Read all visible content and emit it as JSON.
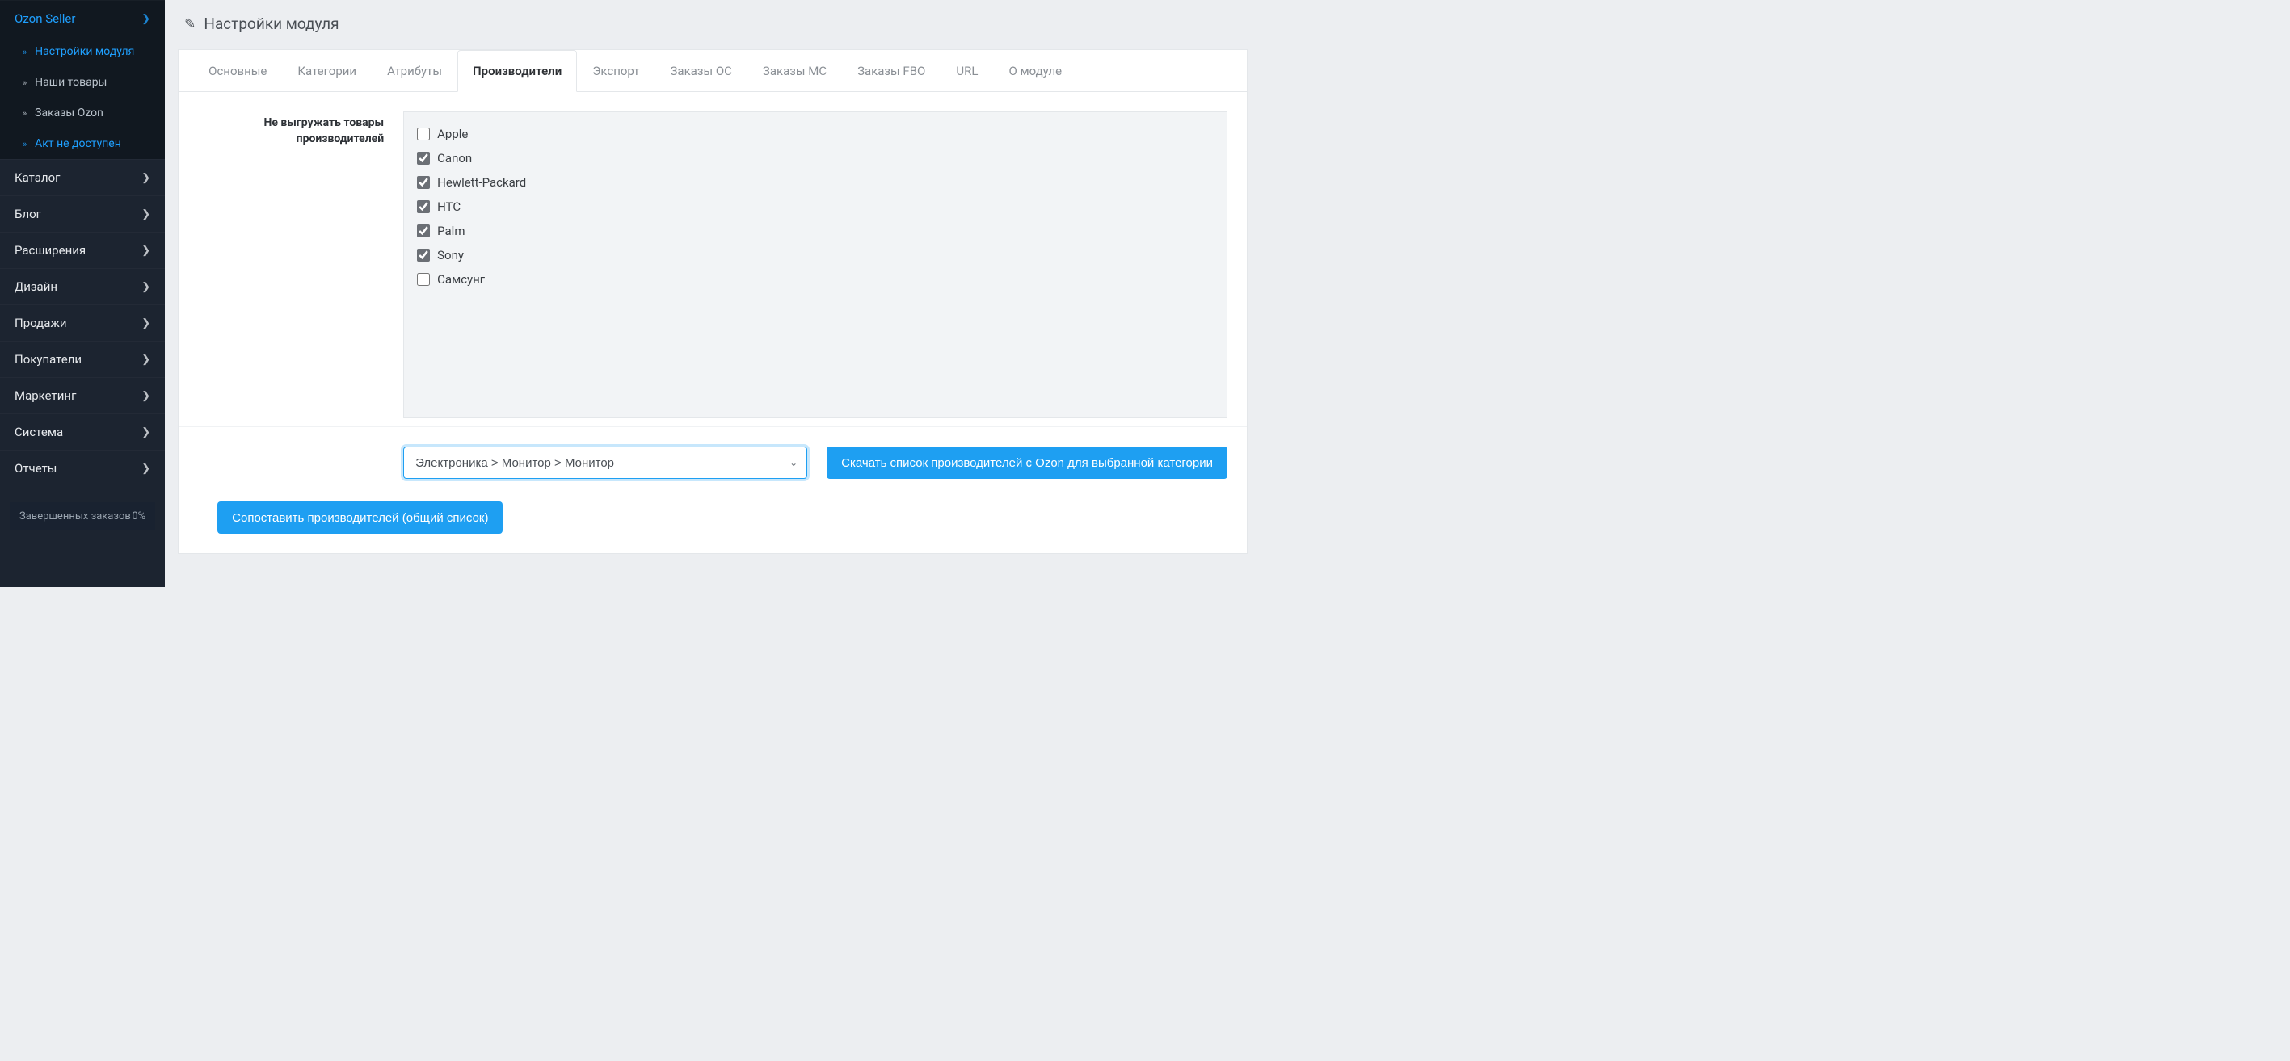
{
  "sidebar": {
    "ozon_seller": {
      "label": "Ozon Seller"
    },
    "sub": [
      {
        "label": "Настройки модуля",
        "active": true
      },
      {
        "label": "Наши товары",
        "active": false
      },
      {
        "label": "Заказы Ozon",
        "active": false
      },
      {
        "label": "Акт не доступен",
        "active": true
      }
    ],
    "items": [
      {
        "label": "Каталог"
      },
      {
        "label": "Блог"
      },
      {
        "label": "Расширения"
      },
      {
        "label": "Дизайн"
      },
      {
        "label": "Продажи"
      },
      {
        "label": "Покупатели"
      },
      {
        "label": "Маркетинг"
      },
      {
        "label": "Система"
      },
      {
        "label": "Отчеты"
      }
    ],
    "footer": {
      "label": "Завершенных заказов",
      "value": "0%"
    }
  },
  "page": {
    "title": "Настройки модуля"
  },
  "tabs": [
    {
      "label": "Основные",
      "active": false
    },
    {
      "label": "Категории",
      "active": false
    },
    {
      "label": "Атрибуты",
      "active": false
    },
    {
      "label": "Производители",
      "active": true
    },
    {
      "label": "Экспорт",
      "active": false
    },
    {
      "label": "Заказы ОС",
      "active": false
    },
    {
      "label": "Заказы МС",
      "active": false
    },
    {
      "label": "Заказы FBO",
      "active": false
    },
    {
      "label": "URL",
      "active": false
    },
    {
      "label": "О модуле",
      "active": false
    }
  ],
  "form": {
    "exclude_label": "Не выгружать товары производителей",
    "manufacturers": [
      {
        "name": "Apple",
        "checked": false
      },
      {
        "name": "Canon",
        "checked": true
      },
      {
        "name": "Hewlett-Packard",
        "checked": true
      },
      {
        "name": "HTC",
        "checked": true
      },
      {
        "name": "Palm",
        "checked": true
      },
      {
        "name": "Sony",
        "checked": true
      },
      {
        "name": "Самсунг",
        "checked": false
      }
    ],
    "category_select": "Электроника > Монитор > Монитор",
    "download_button": "Скачать список производителей с Ozon для выбранной категории",
    "match_button": "Сопоставить производителей (общий список)"
  }
}
